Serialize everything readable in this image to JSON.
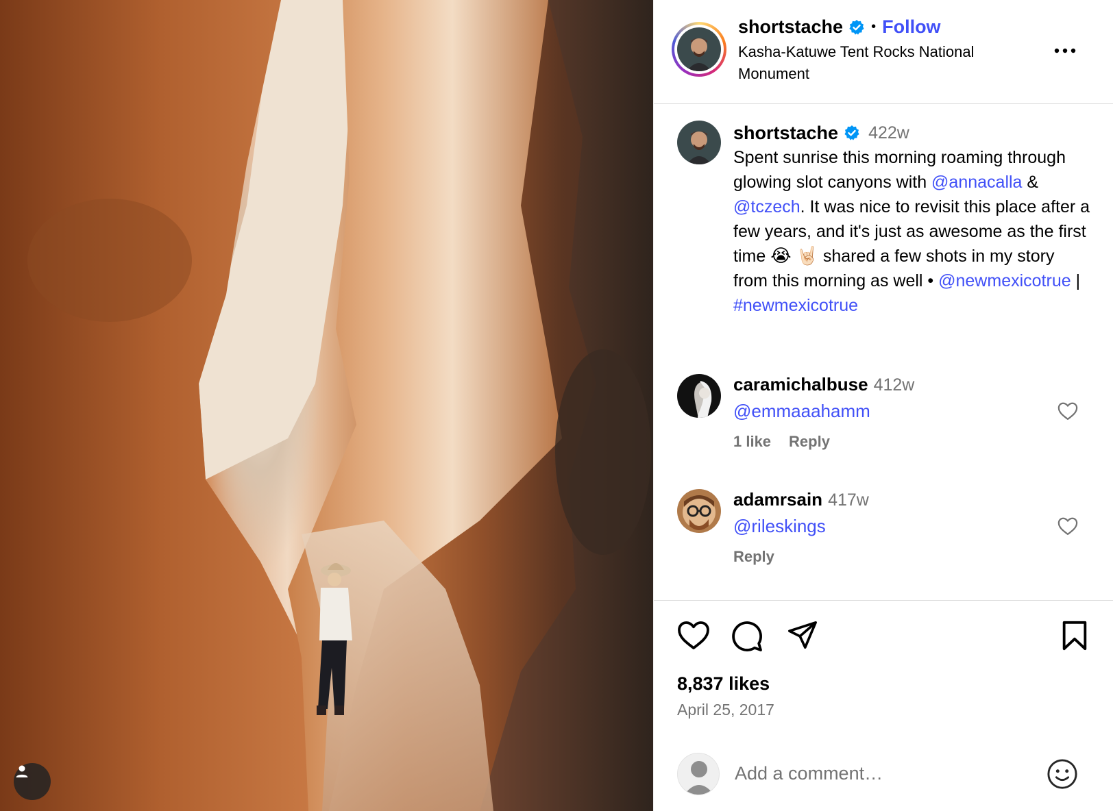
{
  "post": {
    "author": "shortstache",
    "follow_label": "Follow",
    "separator": "•",
    "location": "Kasha-Katuwe Tent Rocks National Monument"
  },
  "caption": {
    "username": "shortstache",
    "time": "422w",
    "part1": "Spent sunrise this morning roaming through glowing slot canyons with ",
    "mention1": "@annacalla",
    "amp": " & ",
    "mention2": "@tczech",
    "part2": ". It was nice to revisit this place after a few years, and it's just as awesome as the first time ",
    "emoji1": "😭",
    "emoji2": "🤘🏻",
    "part3": " shared a few shots in my story from this morning as well • ",
    "mention3": "@newmexicotrue",
    "pipe": " | ",
    "hashtag": "#newmexicotrue"
  },
  "comments": [
    {
      "username": "caramichalbuse",
      "time": "412w",
      "text": "@emmaaahamm",
      "likes": "1 like",
      "reply": "Reply"
    },
    {
      "username": "adamrsain",
      "time": "417w",
      "text": "@rileskings",
      "reply": "Reply"
    }
  ],
  "footer": {
    "likes": "8,837 likes",
    "date": "April 25, 2017",
    "comment_placeholder": "Add a comment…"
  },
  "colors": {
    "link": "#4150f7",
    "muted": "#737373",
    "verified": "#0095f6"
  }
}
